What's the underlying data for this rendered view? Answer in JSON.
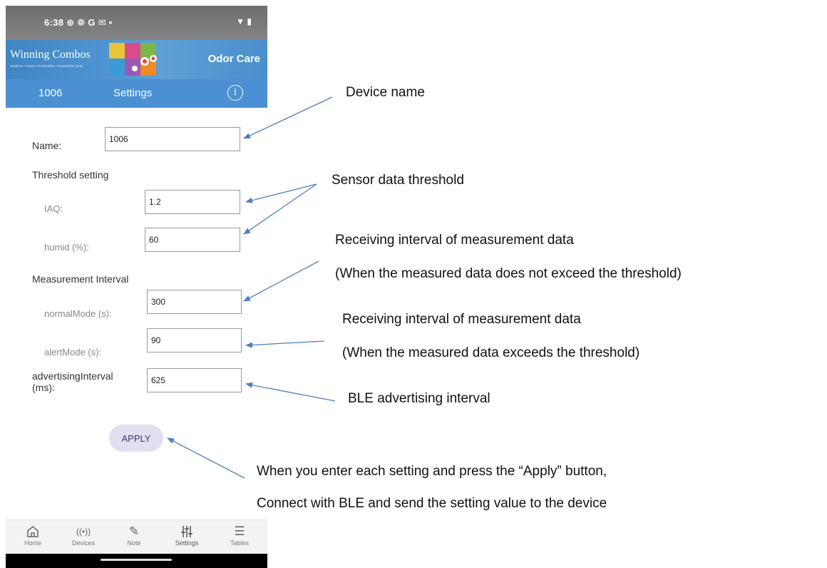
{
  "status_bar": {
    "time": "6:38",
    "notification_icons": "⊕ ❁ G ✉ •",
    "system_icons": "▼ ▮"
  },
  "banner": {
    "title": "Winning Combos",
    "subtitle": "Solutions • Power • Productivity • Competitive Lines",
    "brand": "Odor Care"
  },
  "app_bar": {
    "device": "1006",
    "title": "Settings",
    "info_icon": "ⓘ"
  },
  "form": {
    "name_label": "Name:",
    "name_value": "1006",
    "threshold_section": "Threshold setting",
    "iaq_label": "IAQ:",
    "iaq_value": "1.2",
    "humid_label": "humid (%):",
    "humid_value": "60",
    "interval_section": "Measurement Interval",
    "normal_label": "normalMode (s):",
    "normal_value": "300",
    "alert_label": "alertMode (s):",
    "alert_value": "90",
    "adv_label_line1": "advertisingInterval",
    "adv_label_line2": "(ms):",
    "adv_value": "625",
    "apply_label": "APPLY"
  },
  "bottom_nav": [
    {
      "label": "Home",
      "icon": "home-icon",
      "glyph": "⌂"
    },
    {
      "label": "Devices",
      "icon": "broadcast-icon",
      "glyph": "((•))"
    },
    {
      "label": "Note",
      "icon": "edit-icon",
      "glyph": "✎"
    },
    {
      "label": "Settings",
      "icon": "sliders-icon",
      "glyph": "⫵"
    },
    {
      "label": "Tables",
      "icon": "list-icon",
      "glyph": "☰"
    }
  ],
  "annotations": {
    "device_name": "Device name",
    "sensor_threshold": "Sensor data threshold",
    "normal_interval_1": "Receiving interval of measurement data",
    "normal_interval_2": "(When the measured data does not exceed the threshold)",
    "alert_interval_1": "Receiving interval of measurement data",
    "alert_interval_2": "(When the measured data exceeds the threshold)",
    "ble_interval": "BLE advertising interval",
    "apply_note_1": "When you enter each setting and press the “Apply” button,",
    "apply_note_2": "Connect with BLE and send the setting value to the device"
  },
  "colors": {
    "app_bar": "#4a90d3",
    "apply_button_bg": "#e3def0",
    "arrow": "#4a7fc1"
  }
}
